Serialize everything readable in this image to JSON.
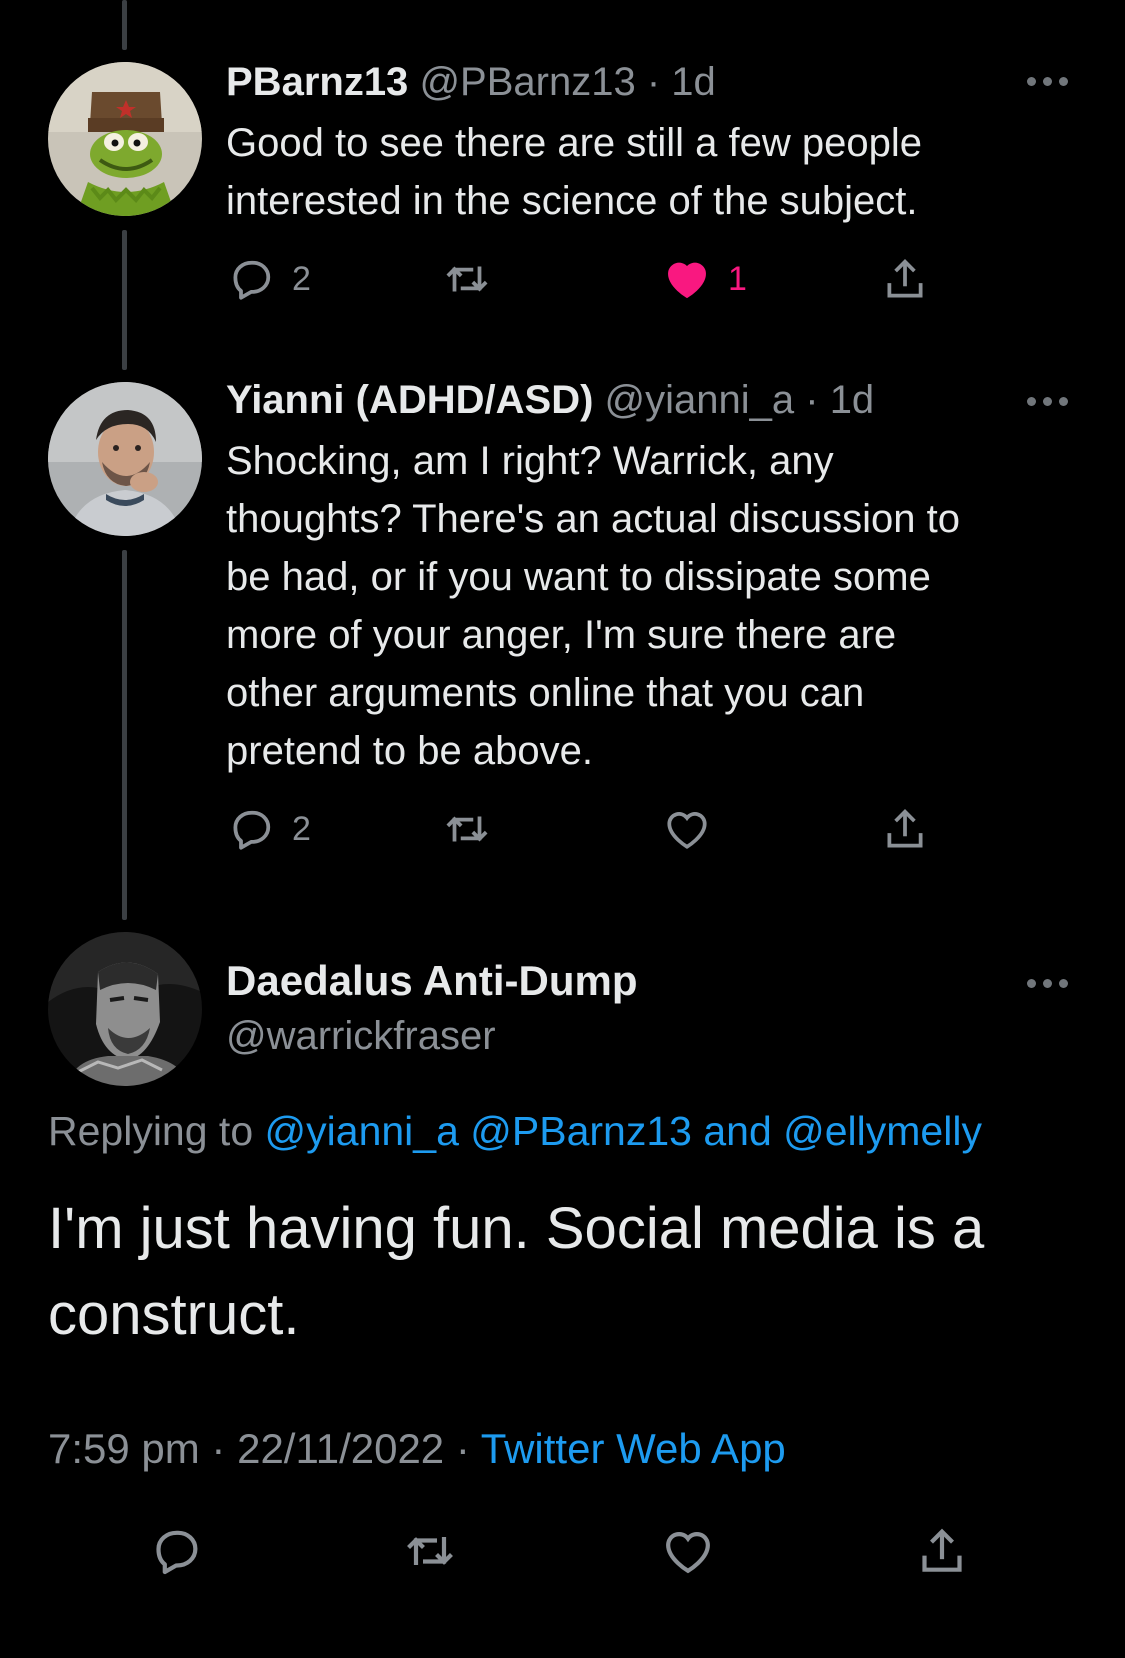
{
  "thread": [
    {
      "name": "PBarnz13",
      "handle": "@PBarnz13",
      "time": "1d",
      "meta": "@PBarnz13 · 1d",
      "text": "Good to see there are still a few people\ninterested in the science of the subject.",
      "avatar": "kermit-avatar",
      "replies": "2",
      "likes": "1",
      "liked": true
    },
    {
      "name": "Yianni (ADHD/ASD)",
      "handle": "@yianni_a",
      "time": "1d",
      "meta": "@yianni_a · 1d",
      "text": "Shocking, am I right? Warrick, any\nthoughts? There's an actual discussion to\nbe had, or if you want to dissipate some\nmore of your anger, I'm sure there are\nother arguments online that you can\npretend to be above.",
      "avatar": "man-avatar",
      "replies": "2",
      "likes": "",
      "liked": false
    }
  ],
  "main_tweet": {
    "name": "Daedalus Anti-Dump",
    "handle": "@warrickfraser",
    "avatar": "game-character-avatar",
    "replying_prefix": "Replying to",
    "replying_links": "@yianni_a @PBarnz13 and @ellymelly",
    "text": "I'm just having fun. Social media is a construct.",
    "time": "7:59 pm · 22/11/2022 ·",
    "source": "Twitter Web App"
  },
  "colors": {
    "background": "#000000",
    "text": "#e7e9ea",
    "secondary": "#8b9096",
    "link": "#1d9bf0",
    "like": "#f91880",
    "thread_line": "#3b3f43"
  },
  "icons": [
    "reply-icon",
    "retweet-icon",
    "heart-icon",
    "share-icon",
    "more-icon"
  ]
}
